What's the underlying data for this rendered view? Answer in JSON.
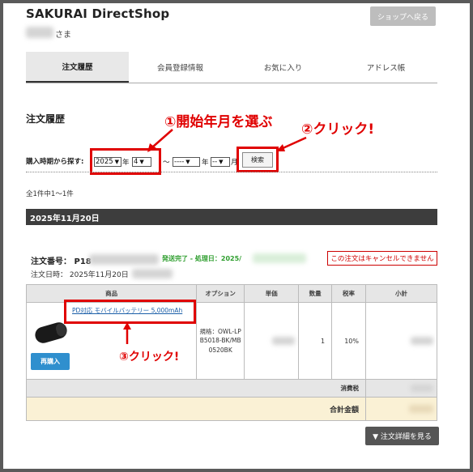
{
  "header": {
    "shop_title": "SAKURAI DirectShop",
    "user_suffix": "さま",
    "back_button": "ショップへ戻る"
  },
  "tabs": [
    {
      "label": "注文履歴",
      "active": true
    },
    {
      "label": "会員登録情報",
      "active": false
    },
    {
      "label": "お気に入り",
      "active": false
    },
    {
      "label": "アドレス帳",
      "active": false
    }
  ],
  "section_title": "注文履歴",
  "annotations": {
    "step1": "①開始年月を選ぶ",
    "step2": "②クリック!",
    "step3": "③クリック!",
    "color": "#e00000"
  },
  "search": {
    "label": "購入時期から探す:",
    "from_year": "2025",
    "year_unit": "年",
    "from_month": "4",
    "month_unit_partial": "月",
    "tilde": "～",
    "to_year": "----",
    "to_month": "--",
    "button": "検索"
  },
  "result_count": "全1件中1～1件",
  "order_group": {
    "date_header": "2025年11月20日",
    "order_number_label": "注文番号：",
    "order_number_prefix": "P18",
    "status": "発送完了 - 処理日：2025/",
    "cancel_note": "この注文はキャンセルできません",
    "order_date_label": "注文日時：",
    "order_date_value": "2025年11月20日"
  },
  "table": {
    "headers": [
      "商品",
      "オプション",
      "単価",
      "数量",
      "税率",
      "小計"
    ],
    "row": {
      "product_name": "PD対応 モバイルバッテリー 5,000mAh",
      "rebuy_button": "再購入",
      "option": "規格：OWL-LPB5018-BK/MB0520BK",
      "quantity": "1",
      "tax_rate": "10%"
    },
    "tax_label": "消費税",
    "total_label": "合計金額"
  },
  "detail_button": "▼ 注文詳細を見る",
  "colors": {
    "accent_blue": "#2f8fce",
    "status_green": "#2e9e2e",
    "date_bar": "#3d3d3d",
    "total_bg": "#faf1d5"
  }
}
